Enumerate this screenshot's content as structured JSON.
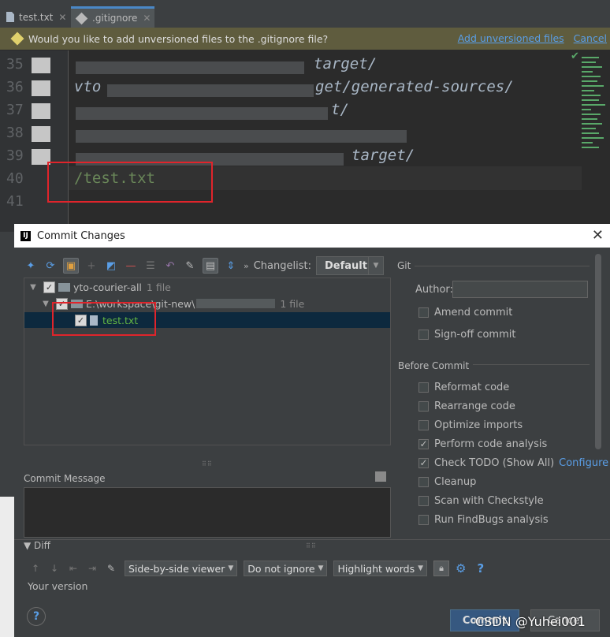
{
  "editor": {
    "tabs": [
      {
        "label": "test.txt"
      },
      {
        "label": ".gitignore"
      }
    ],
    "banner": {
      "text": "Would you like to add unversioned files to the .gitignore file?",
      "add_link": "Add unversioned files",
      "cancel_link": "Cancel"
    },
    "line_numbers": [
      "35",
      "36",
      "37",
      "38",
      "39",
      "40",
      "41"
    ],
    "code_fragments": {
      "l35": "target/",
      "l36a": "vto",
      "l36b": "get/generated-sources/",
      "l37": "t/",
      "l39": "target/",
      "l40": "/test.txt"
    }
  },
  "dialog": {
    "title": "Commit Changes",
    "changelist_label": "Changelist:",
    "changelist_value": "Default",
    "tree": [
      {
        "label": "yto-courier-all",
        "count": "1 file"
      },
      {
        "label": "E:\\workspace\\git-new\\",
        "count": "1 file"
      },
      {
        "label": "test.txt"
      }
    ],
    "commit_message_label": "Commit Message",
    "git": {
      "header": "Git",
      "author_label": "Author:",
      "amend": "Amend commit",
      "signoff": "Sign-off commit"
    },
    "before_commit": {
      "header": "Before Commit",
      "options": [
        {
          "label": "Reformat code",
          "checked": false
        },
        {
          "label": "Rearrange code",
          "checked": false
        },
        {
          "label": "Optimize imports",
          "checked": false
        },
        {
          "label": "Perform code analysis",
          "checked": true
        },
        {
          "label": "Check TODO (Show All)",
          "checked": true,
          "link": "Configure"
        },
        {
          "label": "Cleanup",
          "checked": false
        },
        {
          "label": "Scan with Checkstyle",
          "checked": false
        },
        {
          "label": "Run FindBugs analysis",
          "checked": false
        }
      ]
    },
    "diff": {
      "header": "Diff",
      "viewer": "Side-by-side viewer",
      "ignore": "Do not ignore",
      "highlight": "Highlight words",
      "your_version": "Your version"
    },
    "buttons": {
      "commit": "Commit",
      "cancel": "Cancel"
    }
  },
  "watermark": "CSDN @Yuhei001"
}
